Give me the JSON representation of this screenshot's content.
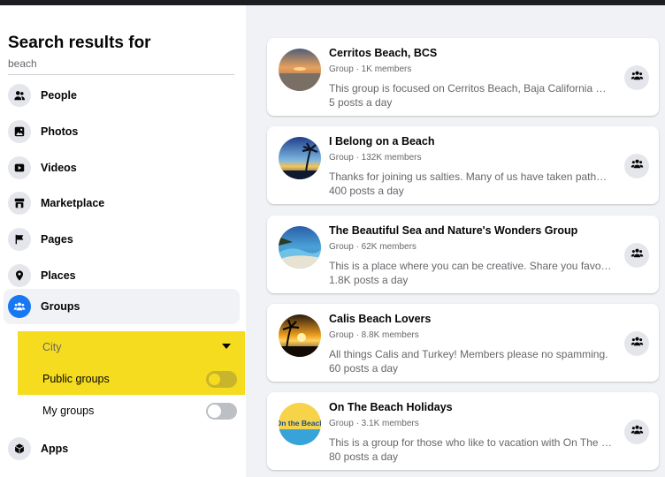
{
  "sidebar": {
    "title": "Search results for",
    "query": "beach",
    "items": [
      {
        "label": "People",
        "icon": "people-icon"
      },
      {
        "label": "Photos",
        "icon": "photos-icon"
      },
      {
        "label": "Videos",
        "icon": "videos-icon"
      },
      {
        "label": "Marketplace",
        "icon": "marketplace-icon"
      },
      {
        "label": "Pages",
        "icon": "flag-icon"
      },
      {
        "label": "Places",
        "icon": "pin-icon"
      },
      {
        "label": "Groups",
        "icon": "groups-icon",
        "active": true
      },
      {
        "label": "Apps",
        "icon": "apps-icon"
      }
    ],
    "filters": {
      "city": {
        "label": "City"
      },
      "public_groups": {
        "label": "Public groups",
        "on": false,
        "highlighted": true
      },
      "my_groups": {
        "label": "My groups",
        "on": false
      }
    }
  },
  "results": [
    {
      "title": "Cerritos Beach, BCS",
      "meta": "Group · 1K members",
      "description": "This group is focused on Cerritos Beach, Baja California Sur, ...",
      "activity": "5 posts a day"
    },
    {
      "title": "I Belong on a Beach",
      "meta": "Group · 132K members",
      "description": "Thanks for joining us salties. Many of us have taken paths in ...",
      "activity": "400 posts a day"
    },
    {
      "title": "The Beautiful Sea and Nature's Wonders Group",
      "meta": "Group · 62K members",
      "description": "This is a place where you can be creative. Share you favorite ...",
      "activity": "1.8K posts a day"
    },
    {
      "title": "Calis Beach Lovers",
      "meta": "Group · 8.8K members",
      "description": "All things Calis and Turkey! Members please no spamming.",
      "activity": "60 posts a day"
    },
    {
      "title": "On The Beach Holidays",
      "meta": "Group · 3.1K members",
      "description": "This is a group for those who like to vacation with On The Be...",
      "activity": "80 posts a day"
    }
  ],
  "logo_text": "On the Beach",
  "colors": {
    "accent": "#1877f2",
    "highlight": "#f6dc1e",
    "background": "#f0f2f5"
  }
}
